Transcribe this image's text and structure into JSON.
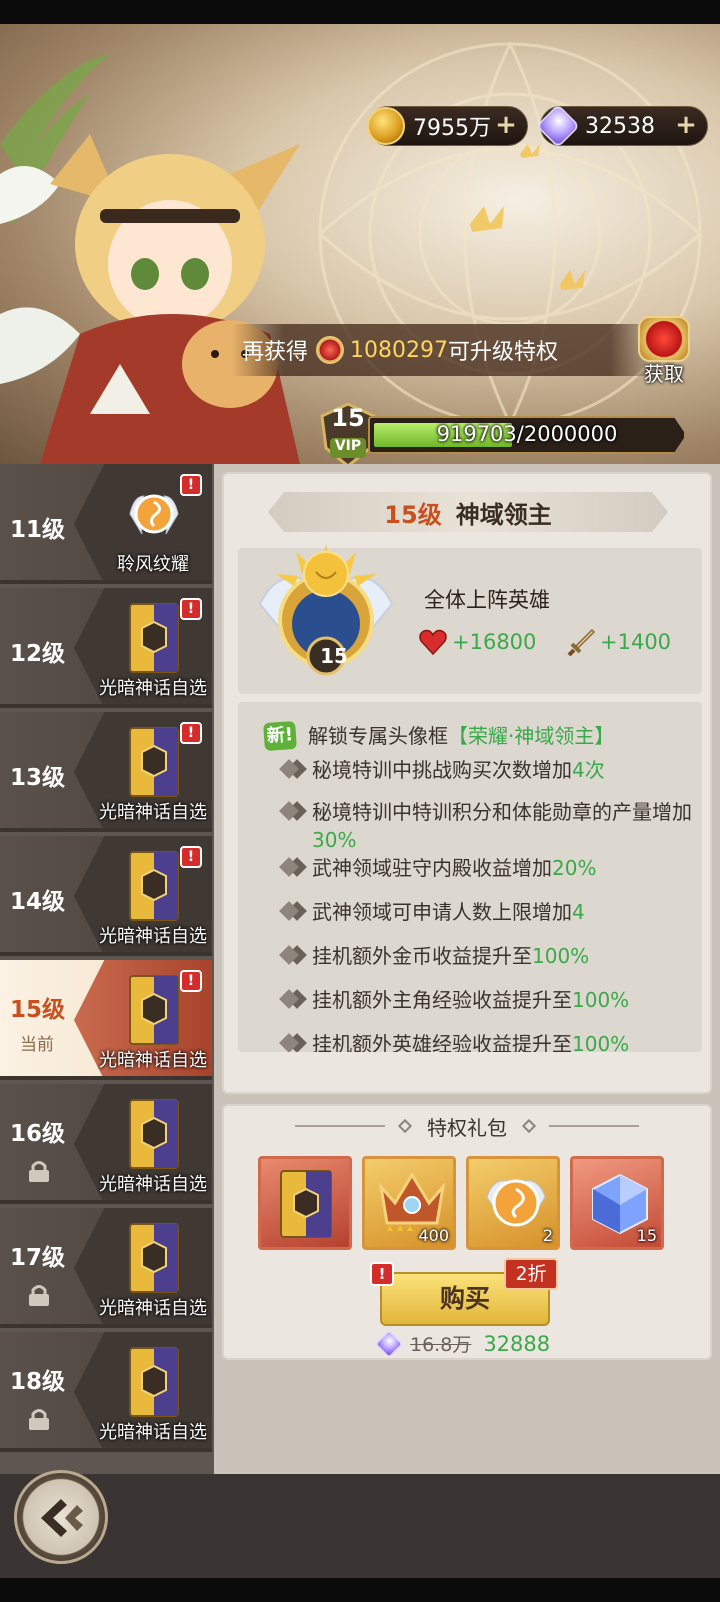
{
  "currency": {
    "gold": {
      "value": "7955万",
      "icon": "gold-coin-icon"
    },
    "gems": {
      "value": "32538",
      "icon": "diamond-icon"
    }
  },
  "vip": {
    "next_label": "再获得",
    "next_amount": "1080297",
    "next_suffix": "可升级特权",
    "get_label": "获取",
    "level": "15",
    "vip_label": "VIP",
    "progress_text": "919703/2000000",
    "progress_current": 919703,
    "progress_max": 2000000
  },
  "levels": [
    {
      "label": "11级",
      "item": "聆风纹耀",
      "sub": ""
    },
    {
      "label": "12级",
      "item": "光暗神话自选",
      "sub": ""
    },
    {
      "label": "13级",
      "item": "光暗神话自选",
      "sub": ""
    },
    {
      "label": "14级",
      "item": "光暗神话自选",
      "sub": ""
    },
    {
      "label": "15级",
      "item": "光暗神话自选",
      "sub": "当前"
    },
    {
      "label": "16级",
      "item": "光暗神话自选",
      "sub": ""
    },
    {
      "label": "17级",
      "item": "光暗神话自选",
      "sub": ""
    },
    {
      "label": "18级",
      "item": "光暗神话自选",
      "sub": ""
    }
  ],
  "detail": {
    "title_level": "15级",
    "title_name": "神域领主",
    "hero_text": "全体上阵英雄",
    "medal_level": "15",
    "hp_bonus": "+16800",
    "atk_bonus": "+1400",
    "new_tag": "新!",
    "unlock_text": "解锁专属头像框",
    "unlock_frame": "【荣耀·神域领主】",
    "perks": [
      {
        "text": "秘境特训中挑战购买次数增加",
        "value": "4次"
      },
      {
        "text": "秘境特训中特训积分和体能勋章的产量增加",
        "value": "30%"
      },
      {
        "text": "武神领域驻守内殿收益增加",
        "value": "20%"
      },
      {
        "text": "武神领域可申请人数上限增加",
        "value": "4"
      },
      {
        "text": "挂机额外金币收益提升至",
        "value": "100%"
      },
      {
        "text": "挂机额外主角经验收益提升至",
        "value": "100%"
      },
      {
        "text": "挂机额外英雄经验收益提升至",
        "value": "100%"
      }
    ]
  },
  "gift": {
    "title": "特权礼包",
    "items": [
      {
        "name": "light-dark-card",
        "count": ""
      },
      {
        "name": "crown",
        "count": "400"
      },
      {
        "name": "wind-emblem",
        "count": "2"
      },
      {
        "name": "crystal-cube",
        "count": "15"
      }
    ],
    "buy_label": "购买",
    "discount": "2折",
    "old_price": "16.8万",
    "new_price": "32888"
  },
  "colors": {
    "accent_orange": "#c9501e",
    "bonus_green": "#3ba84a",
    "progress_green": "#6fb62a",
    "alert_red": "#d62b2b"
  }
}
